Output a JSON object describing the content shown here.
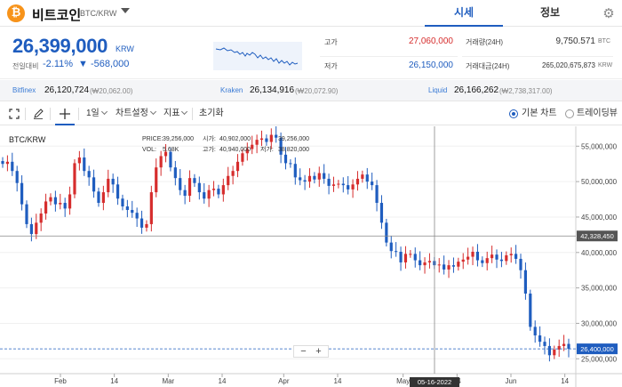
{
  "header": {
    "coin_symbol": "₿",
    "coin_name": "비트코인",
    "pair": "BTC/KRW",
    "tabs": [
      "시세",
      "정보"
    ],
    "settings_icon": "gear-icon"
  },
  "summary": {
    "price": "26,399,000",
    "price_unit": "KRW",
    "change_label": "전일대비",
    "change_pct": "-2.11%",
    "change_amount": "▼ -568,000",
    "high_label": "고가",
    "high_value": "27,060,000",
    "low_label": "저가",
    "low_value": "26,150,000",
    "volume_label": "거래량(24H)",
    "volume_value": "9,750.571",
    "volume_unit": "BTC",
    "turnover_label": "거래대금(24H)",
    "turnover_value": "265,020,675,873",
    "turnover_unit": "KRW"
  },
  "exchanges": [
    {
      "name": "Bitfinex",
      "price": "26,120,724",
      "premium": "(₩20,062.00)"
    },
    {
      "name": "Kraken",
      "price": "26,134,916",
      "premium": "(₩20,072.90)"
    },
    {
      "name": "Liquid",
      "price": "26,166,262",
      "premium": "(₩2,738,317.00)"
    }
  ],
  "toolbar": {
    "interval": "1일",
    "chart_settings": "차트설정",
    "indicators": "지표",
    "reset": "초기화",
    "basic_chart": "기본 차트",
    "tradingview": "트레이딩뷰"
  },
  "chart": {
    "symbol": "BTC/KRW",
    "legend": {
      "price_label": "PRICE:",
      "price": "39,256,000",
      "open_label": "시가:",
      "open": "40,902,000",
      "high_label": "고가:",
      "high": "40,940,000",
      "vol_label": "VOL:",
      "vol": "5.68K",
      "low_label": "저가:",
      "low": "38,820,000",
      "close_value": "39,256,000"
    },
    "zoom_minus": "−",
    "zoom_plus": "+",
    "crosshair_price": "42,328,450",
    "current_price_tag": "26,400,000",
    "crosshair_date": "05-16-2022",
    "colors": {
      "up": "#d62d2d",
      "down": "#1f5dbf",
      "accent": "#1f5dbf"
    }
  },
  "chart_data": {
    "type": "candlestick",
    "title": "BTC/KRW",
    "y_ticks": [
      55000000,
      50000000,
      45000000,
      40000000,
      35000000,
      30000000,
      25000000
    ],
    "y_tick_labels": [
      "55,000,000",
      "50,000,000",
      "45,000,000",
      "40,000,000",
      "35,000,000",
      "30,000,000",
      "25,000,000"
    ],
    "ylim": [
      22900000,
      57800000
    ],
    "x_tick_labels": [
      "Feb",
      "14",
      "Mar",
      "14",
      "Apr",
      "14",
      "May",
      "14",
      "Jun",
      "14"
    ],
    "close_series": [
      52.5,
      52.8,
      51.5,
      49.8,
      46.8,
      44.0,
      42.6,
      44.2,
      45.5,
      47.2,
      47.8,
      46.8,
      47.0,
      46.2,
      48.2,
      52.6,
      53.4,
      51.5,
      50.6,
      48.6,
      47.0,
      48.5,
      50.4,
      49.6,
      47.6,
      46.5,
      46.0,
      45.6,
      44.8,
      43.5,
      44.0,
      48.5,
      52.0,
      53.6,
      54.2,
      52.0,
      50.5,
      48.8,
      48.0,
      50.5,
      49.8,
      48.5,
      47.6,
      48.8,
      49.0,
      48.2,
      49.5,
      50.8,
      51.5,
      52.8,
      54.0,
      54.6,
      55.2,
      55.9,
      56.1,
      55.6,
      56.6,
      56.2,
      53.8,
      52.6,
      52.5,
      50.6,
      50.2,
      50.0,
      50.8,
      50.3,
      51.2,
      50.4,
      49.4,
      49.6,
      49.7,
      49.5,
      48.9,
      49.6,
      50.4,
      51.0,
      50.0,
      49.5,
      47.0,
      44.2,
      41.4,
      40.2,
      40.1,
      38.6,
      39.8,
      39.8,
      38.9,
      38.2,
      38.6,
      38.8,
      38.2,
      38.3,
      37.6,
      38.2,
      38.0,
      38.7,
      39.0,
      39.4,
      40.1,
      38.9,
      38.5,
      39.2,
      39.7,
      39.0,
      38.8,
      39.6,
      39.8,
      39.1,
      37.5,
      34.2,
      29.5,
      28.3,
      27.4,
      26.8,
      25.5,
      26.3,
      26.8,
      27.1,
      26.4
    ],
    "unit": "KRW (millions)"
  }
}
